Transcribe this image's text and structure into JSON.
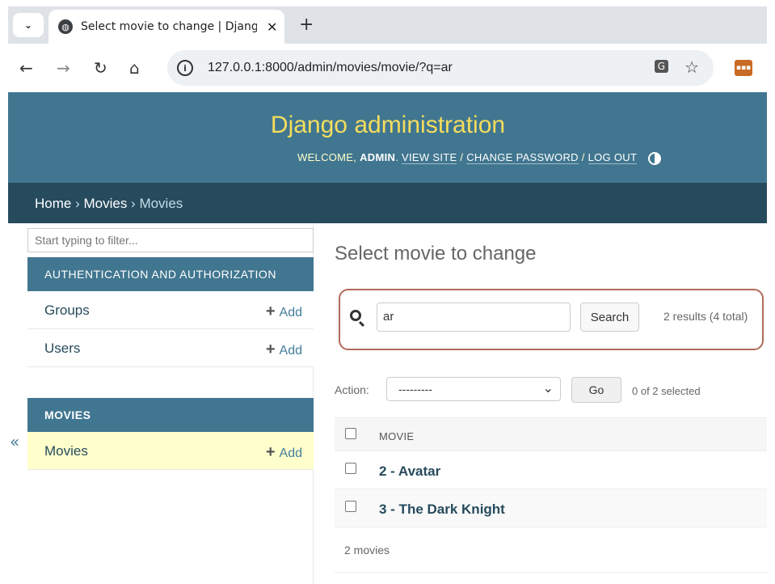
{
  "browser": {
    "tab_title": "Select movie to change | Djang",
    "url": "127.0.0.1:8000/admin/movies/movie/?q=ar",
    "new_tab": "+",
    "close": "✕"
  },
  "header": {
    "branding": "Django administration",
    "welcome": "WELCOME,",
    "user": "ADMIN",
    "view_site": "VIEW SITE",
    "change_password": "CHANGE PASSWORD",
    "log_out": "LOG OUT"
  },
  "breadcrumbs": {
    "home": "Home",
    "app": "Movies",
    "current": "Movies"
  },
  "sidebar": {
    "filter_placeholder": "Start typing to filter...",
    "apps": [
      {
        "caption": "AUTHENTICATION AND AUTHORIZATION",
        "models": [
          {
            "name": "Groups",
            "add": "Add"
          },
          {
            "name": "Users",
            "add": "Add"
          }
        ]
      },
      {
        "caption": "MOVIES",
        "models": [
          {
            "name": "Movies",
            "add": "Add"
          }
        ]
      }
    ],
    "collapse": "«"
  },
  "content": {
    "title": "Select movie to change",
    "search_value": "ar",
    "search_button": "Search",
    "search_count": "2 results (4 total)",
    "action_label": "Action:",
    "action_selected": "---------",
    "go_button": "Go",
    "action_counter": "0 of 2 selected",
    "column_header": "MOVIE",
    "rows": [
      "2 - Avatar",
      "3 - The Dark Knight"
    ],
    "paginator": "2 movies"
  },
  "colors": {
    "header_bg": "#417690",
    "breadcrumb_bg": "#264b5d",
    "brand_yellow": "#f5dd5d",
    "highlight_border": "#b36a5a",
    "current_model_bg": "#ffffcc"
  }
}
